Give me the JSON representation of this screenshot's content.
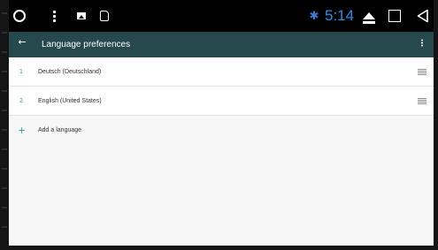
{
  "status_bar": {
    "time": "5:14",
    "time_color": "#2a8fe8",
    "icons": [
      "home-circle-icon",
      "menu-dots-icon",
      "image-icon",
      "sd-card-icon",
      "bluetooth-icon",
      "eject-icon",
      "recents-square-icon",
      "back-triangle-icon"
    ],
    "bluetooth_glyph": "✱"
  },
  "app_bar": {
    "back_glyph": "←",
    "title": "Language preferences",
    "background": "#25494d"
  },
  "languages": [
    {
      "index": "1",
      "name": "Deutsch (Deutschland)"
    },
    {
      "index": "2",
      "name": "English (United States)"
    }
  ],
  "add_language": {
    "plus_glyph": "+",
    "label": "Add a language"
  },
  "accent_color": "#2b9e9a"
}
